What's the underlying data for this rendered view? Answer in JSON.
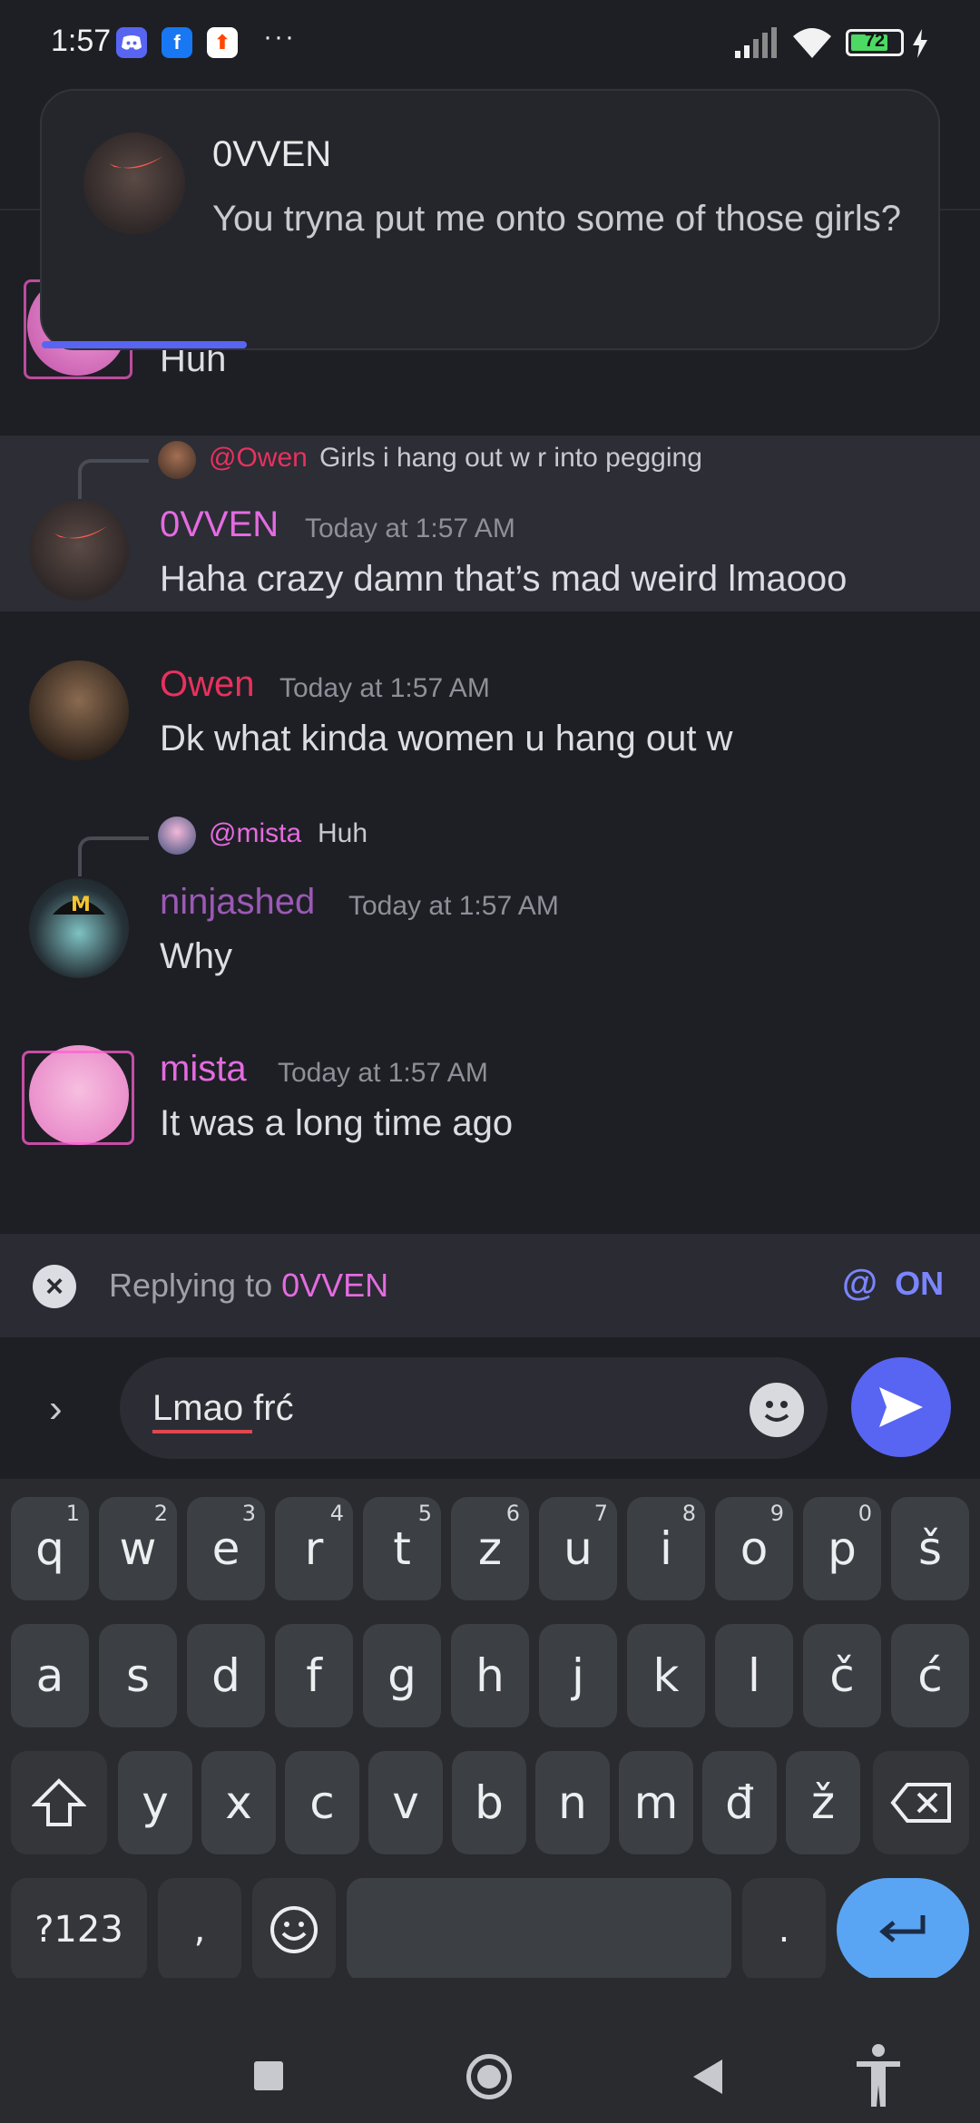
{
  "status_bar": {
    "time": "1:57",
    "battery": "72",
    "more": "···"
  },
  "notification": {
    "sender": "0VVEN",
    "text": "You tryna put me onto some of those girls?"
  },
  "messages": [
    {
      "partial_text": "Huh"
    },
    {
      "reply": {
        "mention": "@Owen",
        "text": "Girls i hang out w r into pegging"
      },
      "username": "0VVEN",
      "timestamp": "Today at 1:57 AM",
      "text": "Haha crazy damn that’s mad weird lmaooo",
      "highlighted": true
    },
    {
      "username": "Owen",
      "timestamp": "Today at 1:57 AM",
      "text": "Dk what kinda women u hang out w"
    },
    {
      "reply": {
        "mention": "@mista",
        "text": "Huh"
      },
      "username": "ninjashed",
      "timestamp": "Today at 1:57 AM",
      "text": "Why"
    },
    {
      "username": "mista",
      "timestamp": "Today at 1:57 AM",
      "text": "It was a long time ago"
    }
  ],
  "reply_bar": {
    "prefix": "Replying to ",
    "target": "0VVEN",
    "mention_icon": "@",
    "mention_state": "ON"
  },
  "composer": {
    "value": "Lmao frć"
  },
  "keyboard": {
    "row1": [
      [
        "q",
        "1"
      ],
      [
        "w",
        "2"
      ],
      [
        "e",
        "3"
      ],
      [
        "r",
        "4"
      ],
      [
        "t",
        "5"
      ],
      [
        "z",
        "6"
      ],
      [
        "u",
        "7"
      ],
      [
        "i",
        "8"
      ],
      [
        "o",
        "9"
      ],
      [
        "p",
        "0"
      ],
      [
        "š",
        ""
      ]
    ],
    "row2": [
      "a",
      "s",
      "d",
      "f",
      "g",
      "h",
      "j",
      "k",
      "l",
      "č",
      "ć"
    ],
    "row3": [
      "y",
      "x",
      "c",
      "v",
      "b",
      "n",
      "m",
      "đ",
      "ž"
    ],
    "symbols": "?123",
    "comma": ",",
    "period": "."
  },
  "colors": {
    "ovven": "#e46be0",
    "owen": "#e8315e",
    "ninjashed": "#9b59b6",
    "mista": "#e46be0",
    "accent": "#5865f2"
  }
}
